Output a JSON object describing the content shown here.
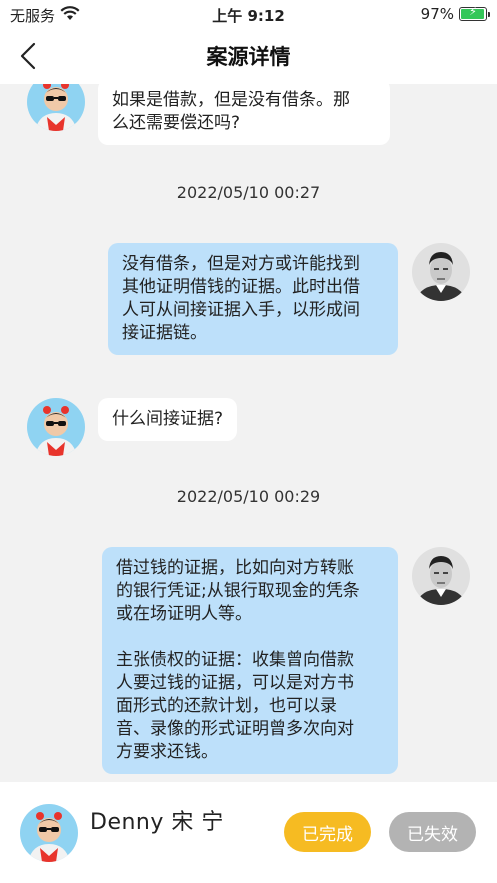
{
  "status_bar": {
    "carrier": "无服务",
    "time": "上午 9:12",
    "battery": "97%",
    "battery_level": 0.97
  },
  "nav": {
    "title": "案源详情"
  },
  "messages": [
    {
      "side": "left",
      "text": "如果是借款，但是没有借条。那\n么还需要偿还吗?"
    },
    {
      "timestamp": "2022/05/10 00:27"
    },
    {
      "side": "right",
      "text": "没有借条，但是对方或许能找到\n其他证明借钱的证据。此时出借\n人可从间接证据入手，以形成间\n接证据链。"
    },
    {
      "side": "left",
      "text": "什么间接证据?"
    },
    {
      "timestamp": "2022/05/10 00:29"
    },
    {
      "side": "right",
      "text": "借过钱的证据，比如向对方转账\n的银行凭证;从银行取现金的凭条\n或在场证明人等。\n\n主张债权的证据：收集曾向借款\n人要过钱的证据，可以是对方书\n面形式的还款计划，也可以录\n音、录像的形式证明曾多次向对\n方要求还钱。"
    }
  ],
  "footer": {
    "name": "Denny 宋 宁",
    "done_label": "已完成",
    "invalid_label": "已失效"
  },
  "colors": {
    "accent": "#f6bb22",
    "disabled": "#b3b3b3",
    "bubble_right": "#bde0fa",
    "bubble_left": "#ffffff",
    "background": "#f2f2f2"
  }
}
